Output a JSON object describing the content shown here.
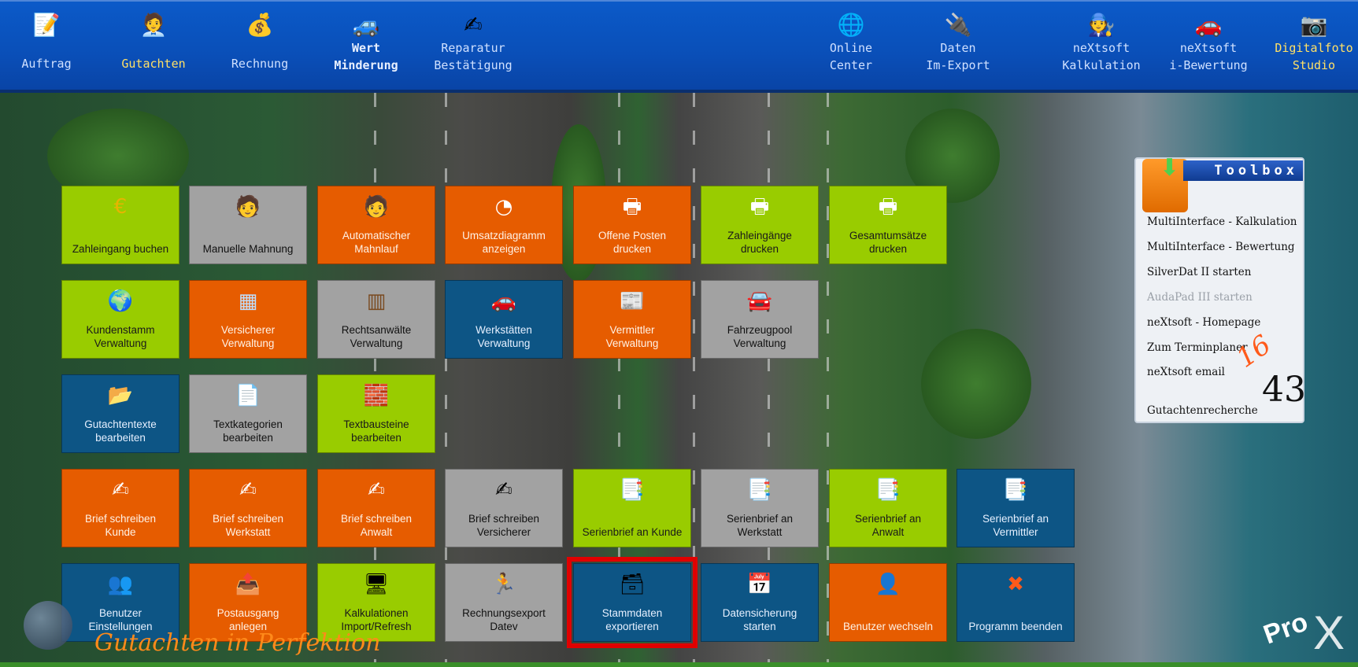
{
  "topnav": {
    "items": [
      {
        "label": "Auftrag",
        "icon": "notepad-pencil-icon"
      },
      {
        "label": "Gutachten",
        "icon": "expert-person-icon"
      },
      {
        "label": "Rechnung",
        "icon": "money-calculator-icon"
      },
      {
        "label": "Wert\nMinderung",
        "icon": "percent-car-icon"
      },
      {
        "label": "Reparatur\nBestätigung",
        "icon": "hand-signature-icon"
      },
      {
        "label": "Online\nCenter",
        "icon": "globe-computer-icon"
      },
      {
        "label": "Daten\nIm-Export",
        "icon": "data-cable-icon"
      },
      {
        "label": "neXtsoft\nKalkulation",
        "icon": "mechanic-icon"
      },
      {
        "label": "neXtsoft\ni-Bewertung",
        "icon": "car-money-icon"
      },
      {
        "label": "Digitalfoto\nStudio",
        "icon": "photo-studio-icon"
      }
    ]
  },
  "tiles": {
    "r1": [
      {
        "label": "Zahleingang buchen",
        "icon": "euro-coin-icon",
        "glyph": "€"
      },
      {
        "label": "Manuelle Mahnung",
        "icon": "person-letter-icon",
        "glyph": "🧑"
      },
      {
        "label": "Automatischer\nMahnlauf",
        "icon": "person-letter-icon",
        "glyph": "🧑"
      },
      {
        "label": "Umsatzdiagramm\nanzeigen",
        "icon": "pie-chart-icon",
        "glyph": "◔"
      },
      {
        "label": "Offene Posten\ndrucken",
        "icon": "printer-icon",
        "glyph": "🖶"
      },
      {
        "label": "Zahleingänge\ndrucken",
        "icon": "printer-icon",
        "glyph": "🖶"
      },
      {
        "label": "Gesamtumsätze\ndrucken",
        "icon": "printer-icon",
        "glyph": "🖶"
      }
    ],
    "r2": [
      {
        "label": "Kundenstamm\nVerwaltung",
        "icon": "customer-globe-icon",
        "glyph": "🌍"
      },
      {
        "label": "Versicherer\nVerwaltung",
        "icon": "building-map-icon",
        "glyph": "▦"
      },
      {
        "label": "Rechtsanwälte\nVerwaltung",
        "icon": "office-building-icon",
        "glyph": "▥"
      },
      {
        "label": "Werkstätten\nVerwaltung",
        "icon": "car-repair-icon",
        "glyph": "🚗"
      },
      {
        "label": "Vermittler\nVerwaltung",
        "icon": "newspaper-icon",
        "glyph": "📰"
      },
      {
        "label": "Fahrzeugpool\nVerwaltung",
        "icon": "red-car-icon",
        "glyph": "🚘"
      }
    ],
    "r3": [
      {
        "label": "Gutachtentexte\nbearbeiten",
        "icon": "folder-icon",
        "glyph": "📂"
      },
      {
        "label": "Textkategorien\nbearbeiten",
        "icon": "document-list-icon",
        "glyph": "📄"
      },
      {
        "label": "Textbausteine\nbearbeiten",
        "icon": "building-blocks-icon",
        "glyph": "🧱"
      }
    ],
    "r4": [
      {
        "label": "Brief schreiben\nKunde",
        "icon": "writing-person-icon",
        "glyph": "✍"
      },
      {
        "label": "Brief schreiben\nWerkstatt",
        "icon": "writing-person-icon",
        "glyph": "✍"
      },
      {
        "label": "Brief schreiben\nAnwalt",
        "icon": "writing-person-icon",
        "glyph": "✍"
      },
      {
        "label": "Brief schreiben\nVersicherer",
        "icon": "writing-person-icon",
        "glyph": "✍"
      },
      {
        "label": "Serienbrief an Kunde",
        "icon": "copy-documents-icon",
        "glyph": "📑"
      },
      {
        "label": "Serienbrief an\nWerkstatt",
        "icon": "copy-documents-icon",
        "glyph": "📑"
      },
      {
        "label": "Serienbrief an\nAnwalt",
        "icon": "copy-documents-icon",
        "glyph": "📑"
      },
      {
        "label": "Serienbrief an\nVermittler",
        "icon": "copy-documents-icon",
        "glyph": "📑"
      }
    ],
    "r5": [
      {
        "label": "Benutzer\nEinstellungen",
        "icon": "users-icon",
        "glyph": "👥"
      },
      {
        "label": "Postausgang\nanlegen",
        "icon": "mail-box-icon",
        "glyph": "📤"
      },
      {
        "label": "Kalkulationen\nImport/Refresh",
        "icon": "computer-refresh-icon",
        "glyph": "🖥"
      },
      {
        "label": "Rechnungsexport\nDatev",
        "icon": "export-person-icon",
        "glyph": "🏃"
      },
      {
        "label": "Stammdaten\nexportieren",
        "icon": "database-export-icon",
        "glyph": "🗃"
      },
      {
        "label": "Datensicherung\nstarten",
        "icon": "calendar-icon",
        "glyph": "📅"
      },
      {
        "label": "Benutzer wechseln",
        "icon": "user-switch-icon",
        "glyph": "👤"
      },
      {
        "label": "Programm beenden",
        "icon": "close-x-icon",
        "glyph": "✖"
      }
    ]
  },
  "toolbox": {
    "title": "Toolbox",
    "links": [
      {
        "label": "MultiInterface - Kalkulation",
        "enabled": true
      },
      {
        "label": "MultiInterface - Bewertung",
        "enabled": true
      },
      {
        "label": "SilverDat II starten",
        "enabled": true
      },
      {
        "label": "AudaPad III starten",
        "enabled": false
      },
      {
        "label": "neXtsoft - Homepage",
        "enabled": true
      },
      {
        "label": "Zum Terminplaner",
        "enabled": true
      },
      {
        "label": "neXtsoft email",
        "enabled": true
      },
      {
        "label": "Gutachtenrecherche",
        "enabled": true
      }
    ],
    "calendar_day": "16",
    "calendar_week": "43"
  },
  "footer": {
    "slogan": "Gutachten in Perfektion",
    "brand": "Pro",
    "brand_mark": "X"
  },
  "colors": {
    "green": "#99cc00",
    "grey": "#a2a2a2",
    "orange": "#e65c00",
    "blue": "#0d5585",
    "selection": "#e00000",
    "topbar": "#0a4fb8"
  }
}
